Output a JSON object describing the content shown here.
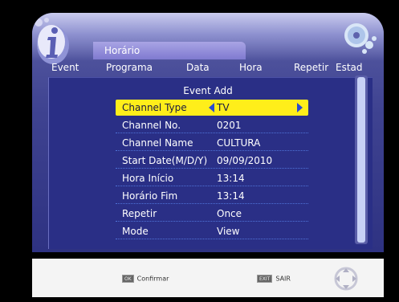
{
  "window": {
    "title": "Horário"
  },
  "columns": [
    "Event",
    "Programa",
    "Data",
    "Hora",
    "Repetir",
    "Estad"
  ],
  "dialog": {
    "title": "Event Add",
    "rows": [
      {
        "label": "Channel Type",
        "value": "TV"
      },
      {
        "label": "Channel No.",
        "value": "0201"
      },
      {
        "label": "Channel Name",
        "value": "CULTURA"
      },
      {
        "label": "Start Date(M/D/Y)",
        "value": "09/09/2010"
      },
      {
        "label": "Hora Início",
        "value": "13:14"
      },
      {
        "label": "Horário Fim",
        "value": "13:14"
      },
      {
        "label": "Repetir",
        "value": "Once"
      },
      {
        "label": "Mode",
        "value": "View"
      }
    ]
  },
  "keys": {
    "ok": {
      "button": "OK",
      "label": "Confirmar"
    },
    "exit": {
      "button": "EXIT",
      "label": "SAIR"
    }
  },
  "icons": {
    "info": "info-icon",
    "disc": "disc-icon",
    "nav": "navigation-pad-icon"
  },
  "colors": {
    "panel": "#3f4391",
    "selection": "#ffee1a",
    "accent_arrow": "#2a4bd0"
  }
}
